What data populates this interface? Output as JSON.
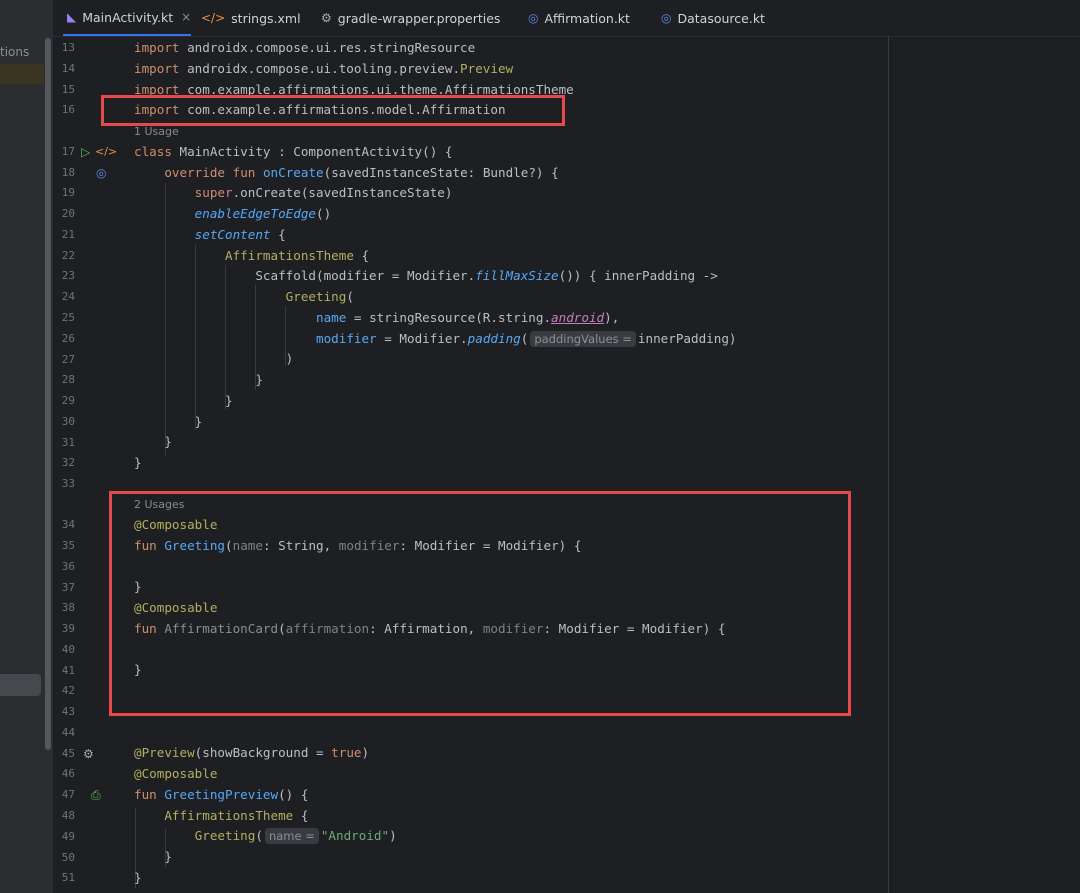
{
  "left_panel": {
    "partial_label": "tions"
  },
  "tabs": [
    {
      "label": "MainActivity.kt",
      "icon": "kotlin-file-icon",
      "active": true,
      "closable": true
    },
    {
      "label": "strings.xml",
      "icon": "xml-file-icon"
    },
    {
      "label": "gradle-wrapper.properties",
      "icon": "gear-file-icon"
    },
    {
      "label": "Affirmation.kt",
      "icon": "kotlin-class-icon"
    },
    {
      "label": "Datasource.kt",
      "icon": "kotlin-class-icon"
    }
  ],
  "tab_close_glyph": "×",
  "line_numbers": [
    "13",
    "14",
    "15",
    "16",
    "17",
    "18",
    "19",
    "20",
    "21",
    "22",
    "23",
    "24",
    "25",
    "26",
    "27",
    "28",
    "29",
    "30",
    "31",
    "32",
    "33",
    "34",
    "35",
    "36",
    "37",
    "38",
    "39",
    "40",
    "41",
    "42",
    "43",
    "44",
    "45",
    "46",
    "47",
    "48",
    "49",
    "50",
    "51"
  ],
  "code": {
    "l13": {
      "kw": "import",
      "rest": " androidx.compose.ui.res.stringResource"
    },
    "l14": {
      "kw": "import",
      "rest": " androidx.compose.ui.tooling.preview.",
      "an": "Preview"
    },
    "l15": {
      "kw": "import",
      "rest": " com.example.affirmations.ui.theme.AffirmationsTheme"
    },
    "l16": {
      "kw": "import",
      "rest": " com.example.affirmations.model.Affirmation"
    },
    "usage1": "1 Usage",
    "l17": {
      "kw": "class",
      "rest": " MainActivity : ComponentActivity() {"
    },
    "l18": {
      "kw1": "override",
      "kw2": "fun",
      "fn": "onCreate",
      "rest": "(savedInstanceState: Bundle?) {"
    },
    "l19": {
      "kw": "super",
      "rest": ".onCreate(savedInstanceState)"
    },
    "l20": {
      "fn": "enableEdgeToEdge",
      "rest": "()"
    },
    "l21": {
      "fn": "setContent",
      "rest": " {"
    },
    "l22": {
      "name": "AffirmationsTheme",
      "rest": " {"
    },
    "l23": {
      "a": "Scaffold(modifier = Modifier.",
      "fn": "fillMaxSize",
      "b": "()) { innerPadding ->"
    },
    "l24": {
      "name": "Greeting",
      "rest": "("
    },
    "l25": {
      "a": "name",
      "b": " = stringResource(R.string.",
      "prop": "android",
      "c": "),"
    },
    "l26": {
      "a": "modifier",
      "b": " = Modifier.",
      "fn": "padding",
      "c": "(",
      "chip": "paddingValues =",
      "d": "innerPadding)"
    },
    "l27": ")",
    "l28": "}",
    "l29": "}",
    "l30": "}",
    "l31": "}",
    "l32": "}",
    "usage2": "2 Usages",
    "l34": "@Composable",
    "l35": {
      "kw": "fun",
      "fn": "Greeting",
      "a": "(",
      "p1": "name",
      "b": ": String, ",
      "p2": "modifier",
      "c": ": Modifier = Modifier) {"
    },
    "l37": "}",
    "l38": "@Composable",
    "l39": {
      "kw": "fun",
      "name": "AffirmationCard",
      "a": "(",
      "p1": "affirmation",
      "b": ": Affirmation, ",
      "p2": "modifier",
      "c": ": Modifier = Modifier) {"
    },
    "l41": "}",
    "l45": {
      "an": "@Preview",
      "a": "(showBackground = ",
      "kw": "true",
      "b": ")"
    },
    "l46": "@Composable",
    "l47": {
      "kw": "fun",
      "fn": "GreetingPreview",
      "rest": "() {"
    },
    "l48": {
      "name": "AffirmationsTheme",
      "rest": " {"
    },
    "l49": {
      "name": "Greeting",
      "a": "(",
      "chip": "name =",
      "str": "\"Android\"",
      "b": ")"
    },
    "l50": "}",
    "l51": "}"
  },
  "colors": {
    "background": "#1e1f22",
    "keyword": "#cf8e6d",
    "function": "#56a8f5",
    "annotation": "#b3ae60",
    "string": "#6aab73",
    "highlight_box": "#e5484d",
    "active_tab_underline": "#3574f0"
  }
}
